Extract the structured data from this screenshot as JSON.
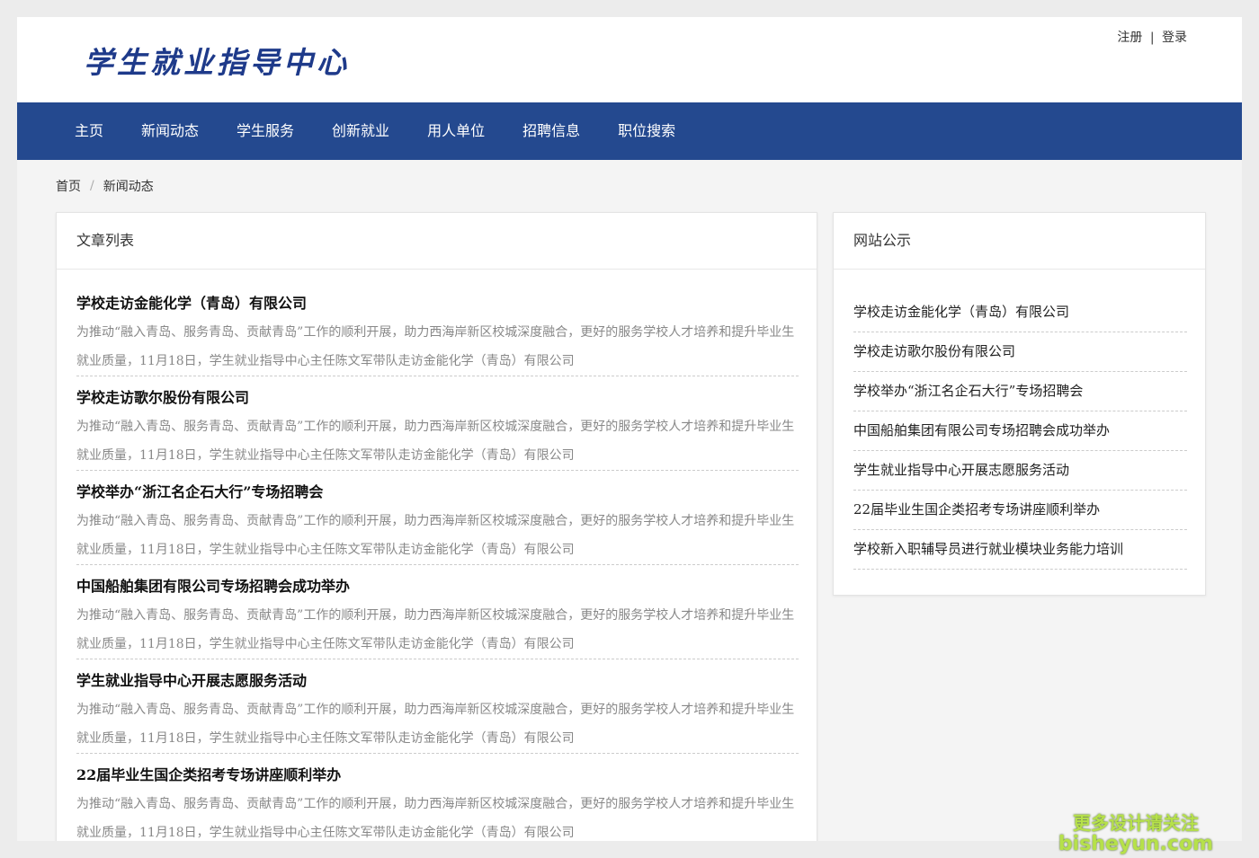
{
  "header": {
    "logo_text": "学生就业指导中心",
    "register": "注册",
    "separator": "|",
    "login": "登录"
  },
  "nav": {
    "items": [
      "主页",
      "新闻动态",
      "学生服务",
      "创新就业",
      "用人单位",
      "招聘信息",
      "职位搜索"
    ]
  },
  "breadcrumb": {
    "home": "首页",
    "separator": "/",
    "current": "新闻动态"
  },
  "article_list": {
    "title": "文章列表",
    "items": [
      {
        "title": "学校走访金能化学（青岛）有限公司",
        "summary": "为推动“融入青岛、服务青岛、贡献青岛”工作的顺利开展，助力西海岸新区校城深度融合，更好的服务学校人才培养和提升毕业生就业质量，11月18日，学生就业指导中心主任陈文军带队走访金能化学（青岛）有限公司"
      },
      {
        "title": "学校走访歌尔股份有限公司",
        "summary": "为推动“融入青岛、服务青岛、贡献青岛”工作的顺利开展，助力西海岸新区校城深度融合，更好的服务学校人才培养和提升毕业生就业质量，11月18日，学生就业指导中心主任陈文军带队走访金能化学（青岛）有限公司"
      },
      {
        "title": "学校举办“浙江名企石大行”专场招聘会",
        "summary": "为推动“融入青岛、服务青岛、贡献青岛”工作的顺利开展，助力西海岸新区校城深度融合，更好的服务学校人才培养和提升毕业生就业质量，11月18日，学生就业指导中心主任陈文军带队走访金能化学（青岛）有限公司"
      },
      {
        "title": "中国船舶集团有限公司专场招聘会成功举办",
        "summary": "为推动“融入青岛、服务青岛、贡献青岛”工作的顺利开展，助力西海岸新区校城深度融合，更好的服务学校人才培养和提升毕业生就业质量，11月18日，学生就业指导中心主任陈文军带队走访金能化学（青岛）有限公司"
      },
      {
        "title": "学生就业指导中心开展志愿服务活动",
        "summary": "为推动“融入青岛、服务青岛、贡献青岛”工作的顺利开展，助力西海岸新区校城深度融合，更好的服务学校人才培养和提升毕业生就业质量，11月18日，学生就业指导中心主任陈文军带队走访金能化学（青岛）有限公司"
      },
      {
        "title": "22届毕业生国企类招考专场讲座顺利举办",
        "summary": "为推动“融入青岛、服务青岛、贡献青岛”工作的顺利开展，助力西海岸新区校城深度融合，更好的服务学校人才培养和提升毕业生就业质量，11月18日，学生就业指导中心主任陈文军带队走访金能化学（青岛）有限公司"
      }
    ]
  },
  "notices": {
    "title": "网站公示",
    "items": [
      "学校走访金能化学（青岛）有限公司",
      "学校走访歌尔股份有限公司",
      "学校举办“浙江名企石大行”专场招聘会",
      "中国船舶集团有限公司专场招聘会成功举办",
      "学生就业指导中心开展志愿服务活动",
      "22届毕业生国企类招考专场讲座顺利举办",
      "学校新入职辅导员进行就业模块业务能力培训"
    ]
  },
  "watermark": {
    "line1": "更多设计请关注",
    "line2": "bisheyun.com"
  }
}
